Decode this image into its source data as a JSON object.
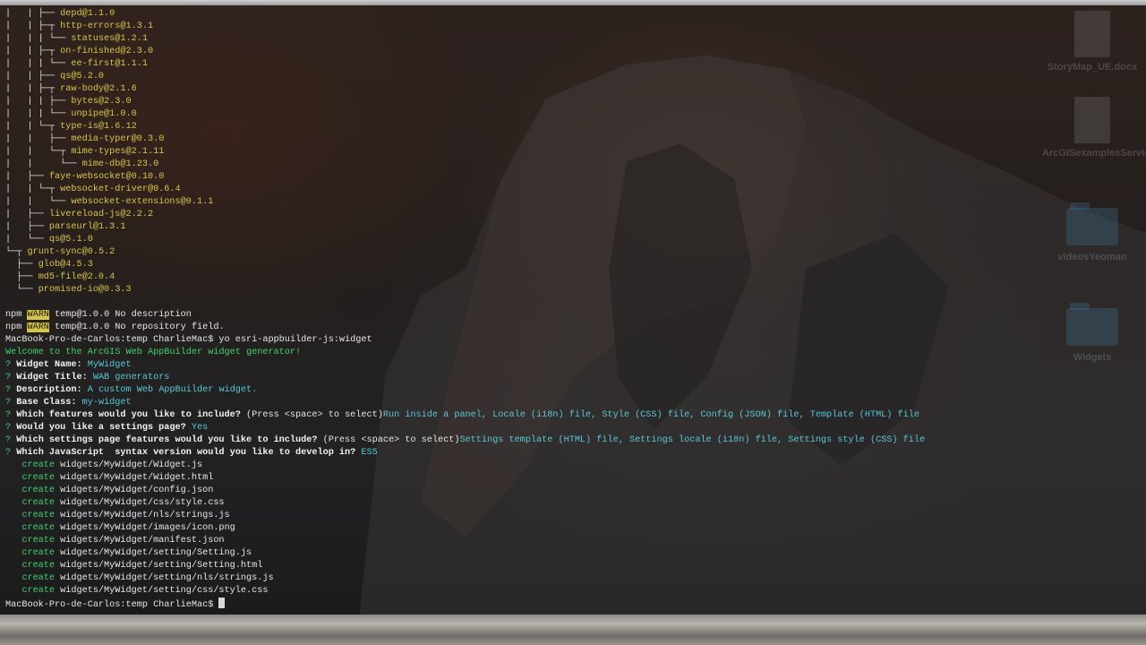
{
  "desktop": {
    "icons": [
      {
        "label": "StoryMap_UE.docx",
        "icon": "word-document-icon"
      },
      {
        "label": "ArcGISexamplesServices.pdf",
        "icon": "pdf-document-icon"
      },
      {
        "label": "videosYeoman",
        "icon": "folder-icon"
      },
      {
        "label": "Widgets",
        "icon": "folder-icon"
      }
    ]
  },
  "terminal": {
    "lines": [
      {
        "segs": [
          {
            "c": "tree",
            "t": "|   | ├── "
          },
          {
            "c": "pkg",
            "t": "depd@1.1.0"
          }
        ]
      },
      {
        "segs": [
          {
            "c": "tree",
            "t": "|   | ├─┬ "
          },
          {
            "c": "pkg",
            "t": "http-errors@1.3.1"
          }
        ]
      },
      {
        "segs": [
          {
            "c": "tree",
            "t": "|   | | └── "
          },
          {
            "c": "pkg",
            "t": "statuses@1.2.1"
          }
        ]
      },
      {
        "segs": [
          {
            "c": "tree",
            "t": "|   | ├─┬ "
          },
          {
            "c": "pkg",
            "t": "on-finished@2.3.0"
          }
        ]
      },
      {
        "segs": [
          {
            "c": "tree",
            "t": "|   | | └── "
          },
          {
            "c": "pkg",
            "t": "ee-first@1.1.1"
          }
        ]
      },
      {
        "segs": [
          {
            "c": "tree",
            "t": "|   | ├── "
          },
          {
            "c": "pkg",
            "t": "qs@5.2.0"
          }
        ]
      },
      {
        "segs": [
          {
            "c": "tree",
            "t": "|   | ├─┬ "
          },
          {
            "c": "pkg",
            "t": "raw-body@2.1.6"
          }
        ]
      },
      {
        "segs": [
          {
            "c": "tree",
            "t": "|   | | ├── "
          },
          {
            "c": "pkg",
            "t": "bytes@2.3.0"
          }
        ]
      },
      {
        "segs": [
          {
            "c": "tree",
            "t": "|   | | └── "
          },
          {
            "c": "pkg",
            "t": "unpipe@1.0.0"
          }
        ]
      },
      {
        "segs": [
          {
            "c": "tree",
            "t": "|   | └─┬ "
          },
          {
            "c": "pkg",
            "t": "type-is@1.6.12"
          }
        ]
      },
      {
        "segs": [
          {
            "c": "tree",
            "t": "|   |   ├── "
          },
          {
            "c": "pkg",
            "t": "media-typer@0.3.0"
          }
        ]
      },
      {
        "segs": [
          {
            "c": "tree",
            "t": "|   |   └─┬ "
          },
          {
            "c": "pkg",
            "t": "mime-types@2.1.11"
          }
        ]
      },
      {
        "segs": [
          {
            "c": "tree",
            "t": "|   |     └── "
          },
          {
            "c": "pkg",
            "t": "mime-db@1.23.0"
          }
        ]
      },
      {
        "segs": [
          {
            "c": "tree",
            "t": "|   ├── "
          },
          {
            "c": "pkg",
            "t": "faye-websocket@0.10.0"
          }
        ]
      },
      {
        "segs": [
          {
            "c": "tree",
            "t": "|   | └─┬ "
          },
          {
            "c": "pkg",
            "t": "websocket-driver@0.6.4"
          }
        ]
      },
      {
        "segs": [
          {
            "c": "tree",
            "t": "|   |   └── "
          },
          {
            "c": "pkg",
            "t": "websocket-extensions@0.1.1"
          }
        ]
      },
      {
        "segs": [
          {
            "c": "tree",
            "t": "|   ├── "
          },
          {
            "c": "pkg",
            "t": "livereload-js@2.2.2"
          }
        ]
      },
      {
        "segs": [
          {
            "c": "tree",
            "t": "|   ├── "
          },
          {
            "c": "pkg",
            "t": "parseurl@1.3.1"
          }
        ]
      },
      {
        "segs": [
          {
            "c": "tree",
            "t": "|   └── "
          },
          {
            "c": "pkg",
            "t": "qs@5.1.0"
          }
        ]
      },
      {
        "segs": [
          {
            "c": "tree",
            "t": "└─┬ "
          },
          {
            "c": "pkg",
            "t": "grunt-sync@0.5.2"
          }
        ]
      },
      {
        "segs": [
          {
            "c": "tree",
            "t": "  ├── "
          },
          {
            "c": "pkg",
            "t": "glob@4.5.3"
          }
        ]
      },
      {
        "segs": [
          {
            "c": "tree",
            "t": "  ├── "
          },
          {
            "c": "pkg",
            "t": "md5-file@2.0.4"
          }
        ]
      },
      {
        "segs": [
          {
            "c": "tree",
            "t": "  └── "
          },
          {
            "c": "pkg",
            "t": "promised-io@0.3.3"
          }
        ]
      },
      {
        "segs": []
      },
      {
        "segs": [
          {
            "c": "",
            "t": "npm "
          },
          {
            "c": "warn",
            "t": "WARN"
          },
          {
            "c": "",
            "t": " temp@1.0.0 No description"
          }
        ]
      },
      {
        "segs": [
          {
            "c": "",
            "t": "npm "
          },
          {
            "c": "warn",
            "t": "WARN"
          },
          {
            "c": "",
            "t": " temp@1.0.0 No repository field."
          }
        ]
      },
      {
        "segs": [
          {
            "c": "",
            "t": "MacBook-Pro-de-Carlos:temp CharlieMac$ yo esri-appbuilder-js:widget"
          }
        ]
      },
      {
        "segs": [
          {
            "c": "green",
            "t": "Welcome to the ArcGIS Web AppBuilder widget generator!"
          }
        ]
      },
      {
        "segs": [
          {
            "c": "green",
            "t": "? "
          },
          {
            "c": "bold",
            "t": "Widget Name: "
          },
          {
            "c": "cyan",
            "t": "MyWidget"
          }
        ]
      },
      {
        "segs": [
          {
            "c": "green",
            "t": "? "
          },
          {
            "c": "bold",
            "t": "Widget Title: "
          },
          {
            "c": "cyan",
            "t": "WAB generators"
          }
        ]
      },
      {
        "segs": [
          {
            "c": "green",
            "t": "? "
          },
          {
            "c": "bold",
            "t": "Description: "
          },
          {
            "c": "cyan",
            "t": "A custom Web AppBuilder widget."
          }
        ]
      },
      {
        "segs": [
          {
            "c": "green",
            "t": "? "
          },
          {
            "c": "bold",
            "t": "Base Class: "
          },
          {
            "c": "cyan",
            "t": "my-widget"
          }
        ]
      },
      {
        "segs": [
          {
            "c": "green",
            "t": "? "
          },
          {
            "c": "bold",
            "t": "Which features would you like to include? "
          },
          {
            "c": "",
            "t": "(Press <space> to select)"
          },
          {
            "c": "cyan",
            "t": "Run inside a panel, Locale (i18n) file, Style (CSS) file, Config (JSON) file, Template (HTML) file"
          }
        ]
      },
      {
        "segs": [
          {
            "c": "green",
            "t": "? "
          },
          {
            "c": "bold",
            "t": "Would you like a settings page? "
          },
          {
            "c": "cyan",
            "t": "Yes"
          }
        ]
      },
      {
        "segs": [
          {
            "c": "green",
            "t": "? "
          },
          {
            "c": "bold",
            "t": "Which settings page features would you like to include? "
          },
          {
            "c": "",
            "t": "(Press <space> to select)"
          },
          {
            "c": "cyan",
            "t": "Settings template (HTML) file, Settings locale (i18n) file, Settings style (CSS) file"
          }
        ]
      },
      {
        "segs": [
          {
            "c": "green",
            "t": "? "
          },
          {
            "c": "bold",
            "t": "Which JavaScript  syntax version would you like to develop in? "
          },
          {
            "c": "cyan",
            "t": "ES5"
          }
        ]
      },
      {
        "segs": [
          {
            "c": "green",
            "t": "   create "
          },
          {
            "c": "",
            "t": "widgets/MyWidget/Widget.js"
          }
        ]
      },
      {
        "segs": [
          {
            "c": "green",
            "t": "   create "
          },
          {
            "c": "",
            "t": "widgets/MyWidget/Widget.html"
          }
        ]
      },
      {
        "segs": [
          {
            "c": "green",
            "t": "   create "
          },
          {
            "c": "",
            "t": "widgets/MyWidget/config.json"
          }
        ]
      },
      {
        "segs": [
          {
            "c": "green",
            "t": "   create "
          },
          {
            "c": "",
            "t": "widgets/MyWidget/css/style.css"
          }
        ]
      },
      {
        "segs": [
          {
            "c": "green",
            "t": "   create "
          },
          {
            "c": "",
            "t": "widgets/MyWidget/nls/strings.js"
          }
        ]
      },
      {
        "segs": [
          {
            "c": "green",
            "t": "   create "
          },
          {
            "c": "",
            "t": "widgets/MyWidget/images/icon.png"
          }
        ]
      },
      {
        "segs": [
          {
            "c": "green",
            "t": "   create "
          },
          {
            "c": "",
            "t": "widgets/MyWidget/manifest.json"
          }
        ]
      },
      {
        "segs": [
          {
            "c": "green",
            "t": "   create "
          },
          {
            "c": "",
            "t": "widgets/MyWidget/setting/Setting.js"
          }
        ]
      },
      {
        "segs": [
          {
            "c": "green",
            "t": "   create "
          },
          {
            "c": "",
            "t": "widgets/MyWidget/setting/Setting.html"
          }
        ]
      },
      {
        "segs": [
          {
            "c": "green",
            "t": "   create "
          },
          {
            "c": "",
            "t": "widgets/MyWidget/setting/nls/strings.js"
          }
        ]
      },
      {
        "segs": [
          {
            "c": "green",
            "t": "   create "
          },
          {
            "c": "",
            "t": "widgets/MyWidget/setting/css/style.css"
          }
        ]
      },
      {
        "segs": [
          {
            "c": "",
            "t": "MacBook-Pro-de-Carlos:temp CharlieMac$ "
          }
        ],
        "cursor": true
      }
    ]
  },
  "colors": {
    "package": "#d7c548",
    "prompt_green": "#3fd16b",
    "answer_cyan": "#56c9d8",
    "warn_bg": "#d7c548"
  }
}
